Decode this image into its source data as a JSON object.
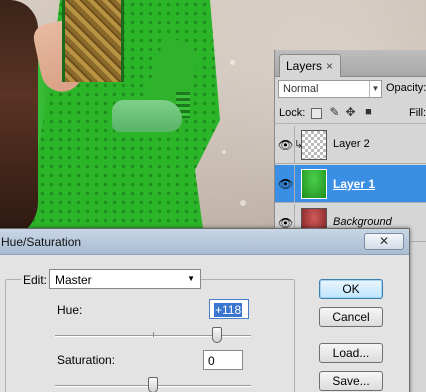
{
  "layers_panel": {
    "tab_label": "Layers",
    "close_glyph": "×",
    "blend_mode": "Normal",
    "opacity_label": "Opacity:",
    "lock_label": "Lock:",
    "fill_label": "Fill:",
    "layers": [
      {
        "name": "Layer 2",
        "visible": true,
        "clipped": true,
        "thumb": "transparent",
        "selected": false
      },
      {
        "name": "Layer 1",
        "visible": true,
        "clipped": false,
        "thumb": "green-dress",
        "selected": true
      },
      {
        "name": "Background",
        "visible": true,
        "clipped": false,
        "thumb": "red-dress",
        "selected": false
      }
    ],
    "icons": {
      "eye": "eye-icon",
      "clip": "clip-arrow-icon",
      "dropdown": "chevron-down-icon"
    }
  },
  "dialog": {
    "title": "Hue/Saturation",
    "close_glyph": "✕",
    "edit_label": "Edit:",
    "edit_value": "Master",
    "hue_label": "Hue:",
    "hue_value": "+118",
    "hue_level": 0.828,
    "saturation_label": "Saturation:",
    "saturation_value": "0",
    "saturation_level": 0.5,
    "buttons": {
      "ok": "OK",
      "cancel": "Cancel",
      "load": "Load...",
      "save": "Save..."
    }
  }
}
